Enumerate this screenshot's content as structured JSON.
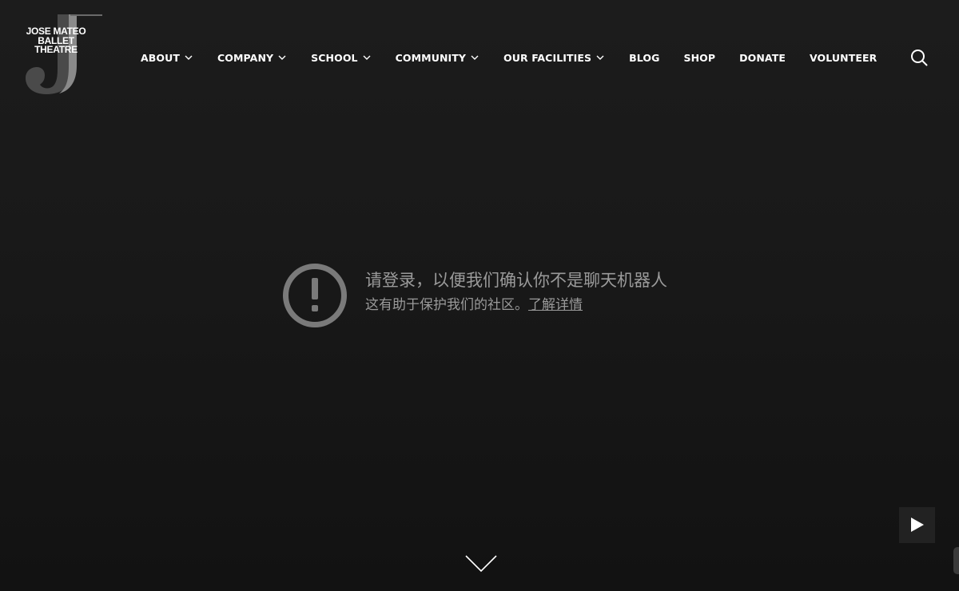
{
  "logo": {
    "lines": [
      "JOSE MATEO",
      "BALLET",
      "THEATRE"
    ]
  },
  "nav": {
    "items": [
      {
        "label": "ABOUT",
        "dropdown": true
      },
      {
        "label": "COMPANY",
        "dropdown": true
      },
      {
        "label": "SCHOOL",
        "dropdown": true
      },
      {
        "label": "COMMUNITY",
        "dropdown": true
      },
      {
        "label": "OUR FACILITIES",
        "dropdown": true
      },
      {
        "label": "BLOG",
        "dropdown": false
      },
      {
        "label": "SHOP",
        "dropdown": false
      },
      {
        "label": "DONATE",
        "dropdown": false
      },
      {
        "label": "VOLUNTEER",
        "dropdown": false
      }
    ],
    "search_icon": "search-icon"
  },
  "notice": {
    "icon": "exclamation-circle-icon",
    "title": "请登录，以便我们确认你不是聊天机器人",
    "subtitle": "这有助于保护我们的社区。",
    "link": "了解详情"
  },
  "controls": {
    "play_icon": "play-icon",
    "scroll_icon": "chevron-down-icon"
  },
  "colors": {
    "background": "#1a1a1a",
    "text": "#ffffff",
    "muted": "#9a9a9a"
  }
}
